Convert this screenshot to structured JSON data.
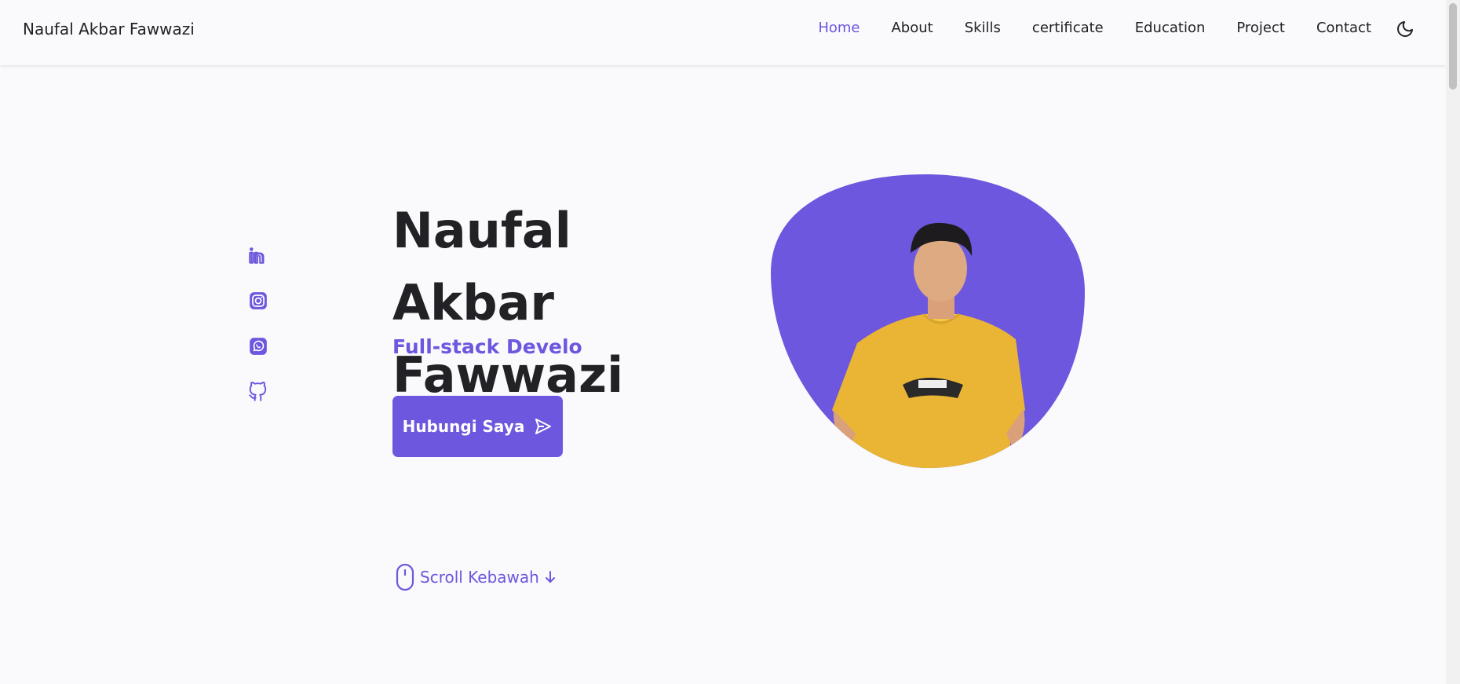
{
  "header": {
    "logo": "Naufal Akbar Fawwazi",
    "nav": [
      {
        "label": "Home",
        "active": true
      },
      {
        "label": "About"
      },
      {
        "label": "Skills"
      },
      {
        "label": "certificate"
      },
      {
        "label": "Education"
      },
      {
        "label": "Project"
      },
      {
        "label": "Contact"
      }
    ],
    "theme_icon": "moon-icon"
  },
  "social": [
    "linkedin-icon",
    "instagram-icon",
    "whatsapp-icon",
    "github-icon"
  ],
  "hero": {
    "title_line1": "Naufal Akbar",
    "title_line2": "Fawwazi",
    "subtitle": "Full-stack Develo",
    "cta_label": "Hubungi Saya",
    "cta_icon": "send-icon",
    "scroll_label": "Scroll Kebawah"
  },
  "colors": {
    "accent": "#6c57de",
    "background": "#fafafc",
    "text": "#222226"
  }
}
